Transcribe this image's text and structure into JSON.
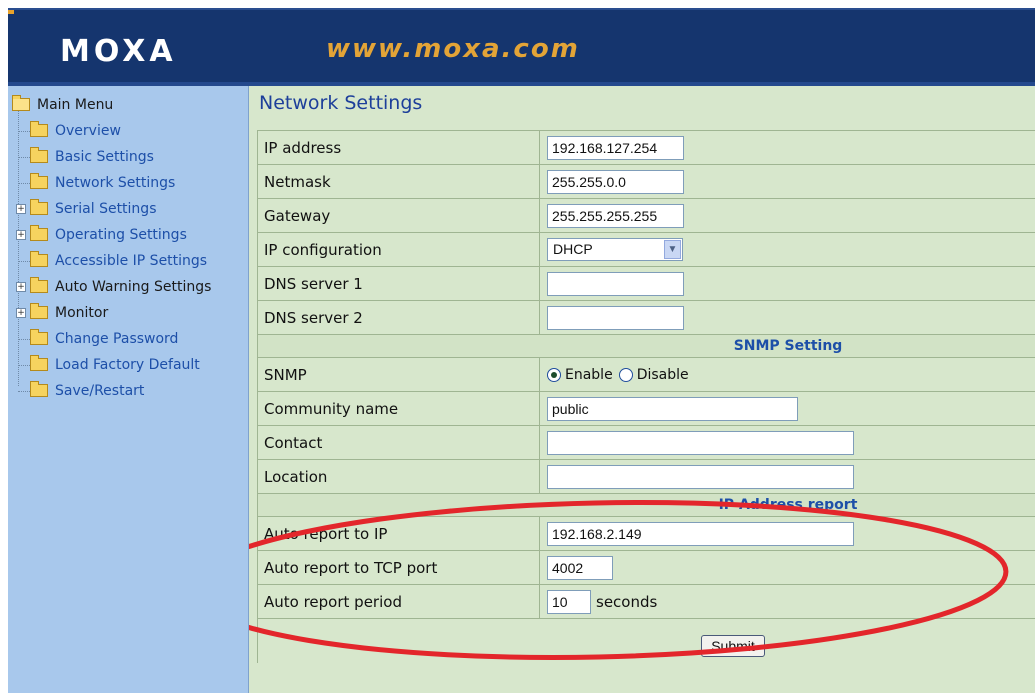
{
  "header": {
    "logo": "MOXA",
    "site": "www.moxa.com"
  },
  "sidebar": {
    "root": "Main Menu",
    "items": [
      {
        "label": "Overview",
        "expandable": false
      },
      {
        "label": "Basic Settings",
        "expandable": false
      },
      {
        "label": "Network Settings",
        "expandable": false
      },
      {
        "label": "Serial Settings",
        "expandable": true
      },
      {
        "label": "Operating Settings",
        "expandable": true
      },
      {
        "label": "Accessible IP Settings",
        "expandable": false
      },
      {
        "label": "Auto Warning Settings",
        "expandable": true
      },
      {
        "label": "Monitor",
        "expandable": true
      },
      {
        "label": "Change Password",
        "expandable": false
      },
      {
        "label": "Load Factory Default",
        "expandable": false
      },
      {
        "label": "Save/Restart",
        "expandable": false
      }
    ],
    "expand_glyph": "+"
  },
  "main": {
    "title": "Network Settings",
    "ip_address": {
      "label": "IP address",
      "value": "192.168.127.254"
    },
    "netmask": {
      "label": "Netmask",
      "value": "255.255.0.0"
    },
    "gateway": {
      "label": "Gateway",
      "value": "255.255.255.255"
    },
    "ip_config": {
      "label": "IP configuration",
      "value": "DHCP"
    },
    "dns1": {
      "label": "DNS server 1",
      "value": ""
    },
    "dns2": {
      "label": "DNS server 2",
      "value": ""
    },
    "snmp_section": "SNMP Setting",
    "snmp": {
      "label": "SNMP",
      "enable": "Enable",
      "disable": "Disable",
      "selected": "Enable"
    },
    "community": {
      "label": "Community name",
      "value": "public"
    },
    "contact": {
      "label": "Contact",
      "value": ""
    },
    "location": {
      "label": "Location",
      "value": ""
    },
    "ip_report_section": "IP Address report",
    "auto_ip": {
      "label": "Auto report to IP",
      "value": "192.168.2.149"
    },
    "auto_port": {
      "label": "Auto report to TCP port",
      "value": "4002"
    },
    "auto_period": {
      "label": "Auto report period",
      "value": "10",
      "unit": "seconds"
    },
    "submit": "Submit"
  },
  "colors": {
    "header_bg": "#15356e",
    "logo_accent": "#e3a437",
    "sidebar_bg": "#a8c8ec",
    "main_bg": "#d7e7cc",
    "section_title": "#1d4fa8",
    "annotation_ellipse": "#e3262b"
  }
}
